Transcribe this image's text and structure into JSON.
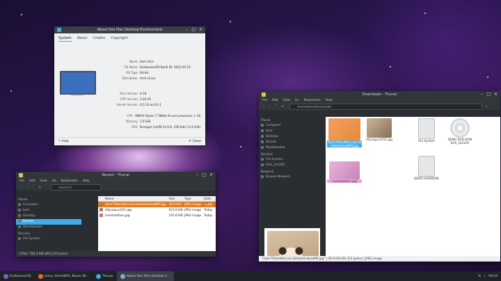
{
  "about": {
    "title": "About this Plan Desktop Environment",
    "tabs": [
      "System",
      "About",
      "Credits",
      "Copyright"
    ],
    "rows": [
      {
        "k": "Name",
        "v": "bem-xfce"
      },
      {
        "k": "OS Name",
        "v": "EndeavourOS Build ID: 2022.05.15"
      },
      {
        "k": "OS Type",
        "v": "64-bit"
      },
      {
        "k": "Distributor",
        "v": "Arch Linux"
      },
      {
        "k": "Xfce Version",
        "v": "4.18"
      },
      {
        "k": "GTK Version",
        "v": "3.24.35"
      },
      {
        "k": "Kernel Version",
        "v": "6.0.12-arch1-1"
      },
      {
        "k": "CPU",
        "v": "AMD® Ryzen 7 5800x 8-core processor × 16"
      },
      {
        "k": "Memory",
        "v": "1.9 GiB"
      },
      {
        "k": "GPU",
        "v": "llvmpipe (LLVM 14.0.6, 256 bits) (1.9 GiB)"
      }
    ],
    "help": "Help",
    "close": "Close"
  },
  "recent": {
    "title": "Recent - Thunar",
    "menu": [
      "File",
      "Edit",
      "View",
      "Go",
      "Bookmarks",
      "Help"
    ],
    "path": "recent:///",
    "places_head": "Places",
    "places": [
      "Computer",
      "bem",
      "Desktop",
      "Recent",
      "Wastebasket"
    ],
    "devices_head": "Devices",
    "devices": [
      "File System"
    ],
    "columns": [
      "Name",
      "Size",
      "Type",
      "Date Mo"
    ],
    "rows": [
      {
        "name": "3a4c7f54ed9b1ca2c184ebd1ebea890.jpg",
        "size": "58.9 KiB",
        "type": "JPEG image",
        "date": "Today"
      },
      {
        "name": "dlcjrzqucczf11.jpg",
        "size": "623.8 KiB",
        "type": "JPEG image",
        "date": "Today"
      },
      {
        "name": "insertoteface.jpg",
        "size": "101.6 KiB",
        "type": "JPEG image",
        "date": "Today"
      }
    ],
    "status": "3 files: 784.4 KiB (803,230 bytes)"
  },
  "downloads": {
    "title": "Downloads - Thunar",
    "menu": [
      "File",
      "Edit",
      "View",
      "Go",
      "Bookmarks",
      "Help"
    ],
    "path": "/home/bem/Downloads/",
    "places_head": "Places",
    "places": [
      "Computer",
      "bem",
      "Desktop",
      "Recent",
      "Wastebasket"
    ],
    "devices_head": "Devices",
    "devices": [
      "File System",
      "EOS_202205"
    ],
    "network_head": "Network",
    "network": [
      "Browse Network"
    ],
    "items": [
      {
        "label": "3a4c7f54ed9b1ca2c184ebd1ebea890.jpg"
      },
      {
        "label": "dlcjrzqucczf11.jpg"
      },
      {
        "label": "File System"
      },
      {
        "label": "QEMU DVD-ROM EOS_202205"
      },
      {
        "label": "insertoteface.jpg"
      },
      {
        "label": "QEMU HARDDISK"
      }
    ],
    "status": "\"3a4c7f54ed9b1ca2c184ebd1ebea890.jpg\" | 58.9 KiB (60,314 bytes) | JPEG image"
  },
  "taskbar": {
    "items": [
      "EndeavourOS",
      "Linux, Xmm8hf5, Boom 06...",
      "Thunar",
      "About this Xfce Desktop E..."
    ],
    "clock": "09:54"
  }
}
